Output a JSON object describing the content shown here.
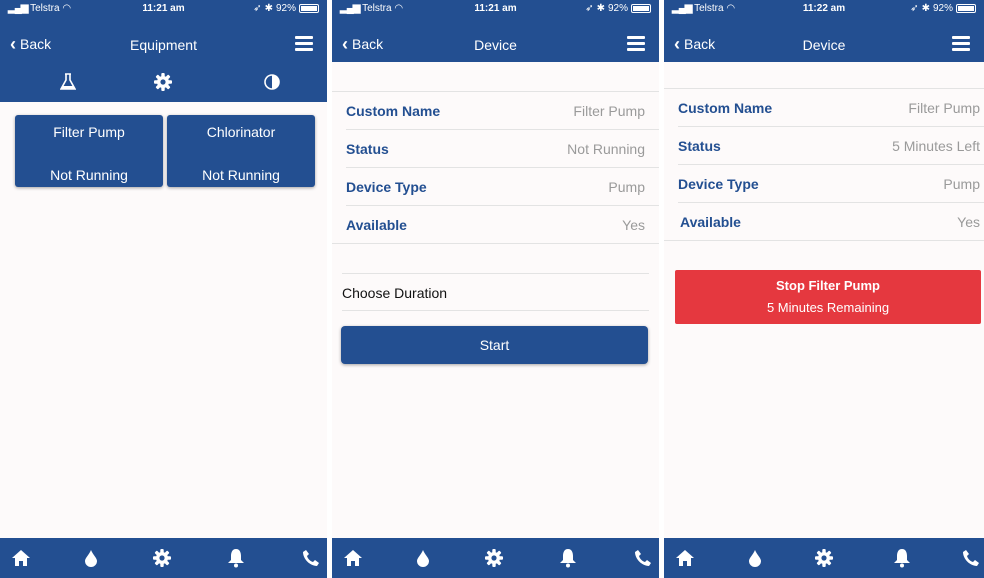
{
  "colors": {
    "primary": "#234f91",
    "danger": "#e5383f",
    "label": "#234f91",
    "value_text": "#9a9a9a"
  },
  "screens": [
    {
      "status_bar": {
        "carrier": "Telstra",
        "time": "11:21 am",
        "battery": "92%"
      },
      "navbar": {
        "back_label": "Back",
        "title": "Equipment"
      },
      "subtabs": [
        "flask-icon",
        "gear-icon",
        "contrast-icon"
      ],
      "equipment": [
        {
          "name": "Filter Pump",
          "state": "Not Running"
        },
        {
          "name": "Chlorinator",
          "state": "Not Running"
        }
      ]
    },
    {
      "status_bar": {
        "carrier": "Telstra",
        "time": "11:21 am",
        "battery": "92%"
      },
      "navbar": {
        "back_label": "Back",
        "title": "Device"
      },
      "details": [
        {
          "label": "Custom Name",
          "value": "Filter Pump"
        },
        {
          "label": "Status",
          "value": "Not Running"
        },
        {
          "label": "Device Type",
          "value": "Pump"
        },
        {
          "label": "Available",
          "value": "Yes"
        }
      ],
      "duration_label": "Choose Duration",
      "start_label": "Start"
    },
    {
      "status_bar": {
        "carrier": "Telstra",
        "time": "11:22 am",
        "battery": "92%"
      },
      "navbar": {
        "back_label": "Back",
        "title": "Device"
      },
      "details": [
        {
          "label": "Custom Name",
          "value": "Filter Pump"
        },
        {
          "label": "Status",
          "value": "5 Minutes Left"
        },
        {
          "label": "Device Type",
          "value": "Pump"
        },
        {
          "label": "Available",
          "value": "Yes"
        }
      ],
      "stop_button": {
        "title": "Stop Filter Pump",
        "subtitle": "5 Minutes Remaining"
      }
    }
  ],
  "tab_bar": [
    "home-icon",
    "water-drop-icon",
    "gear-icon",
    "bell-icon",
    "phone-icon"
  ]
}
